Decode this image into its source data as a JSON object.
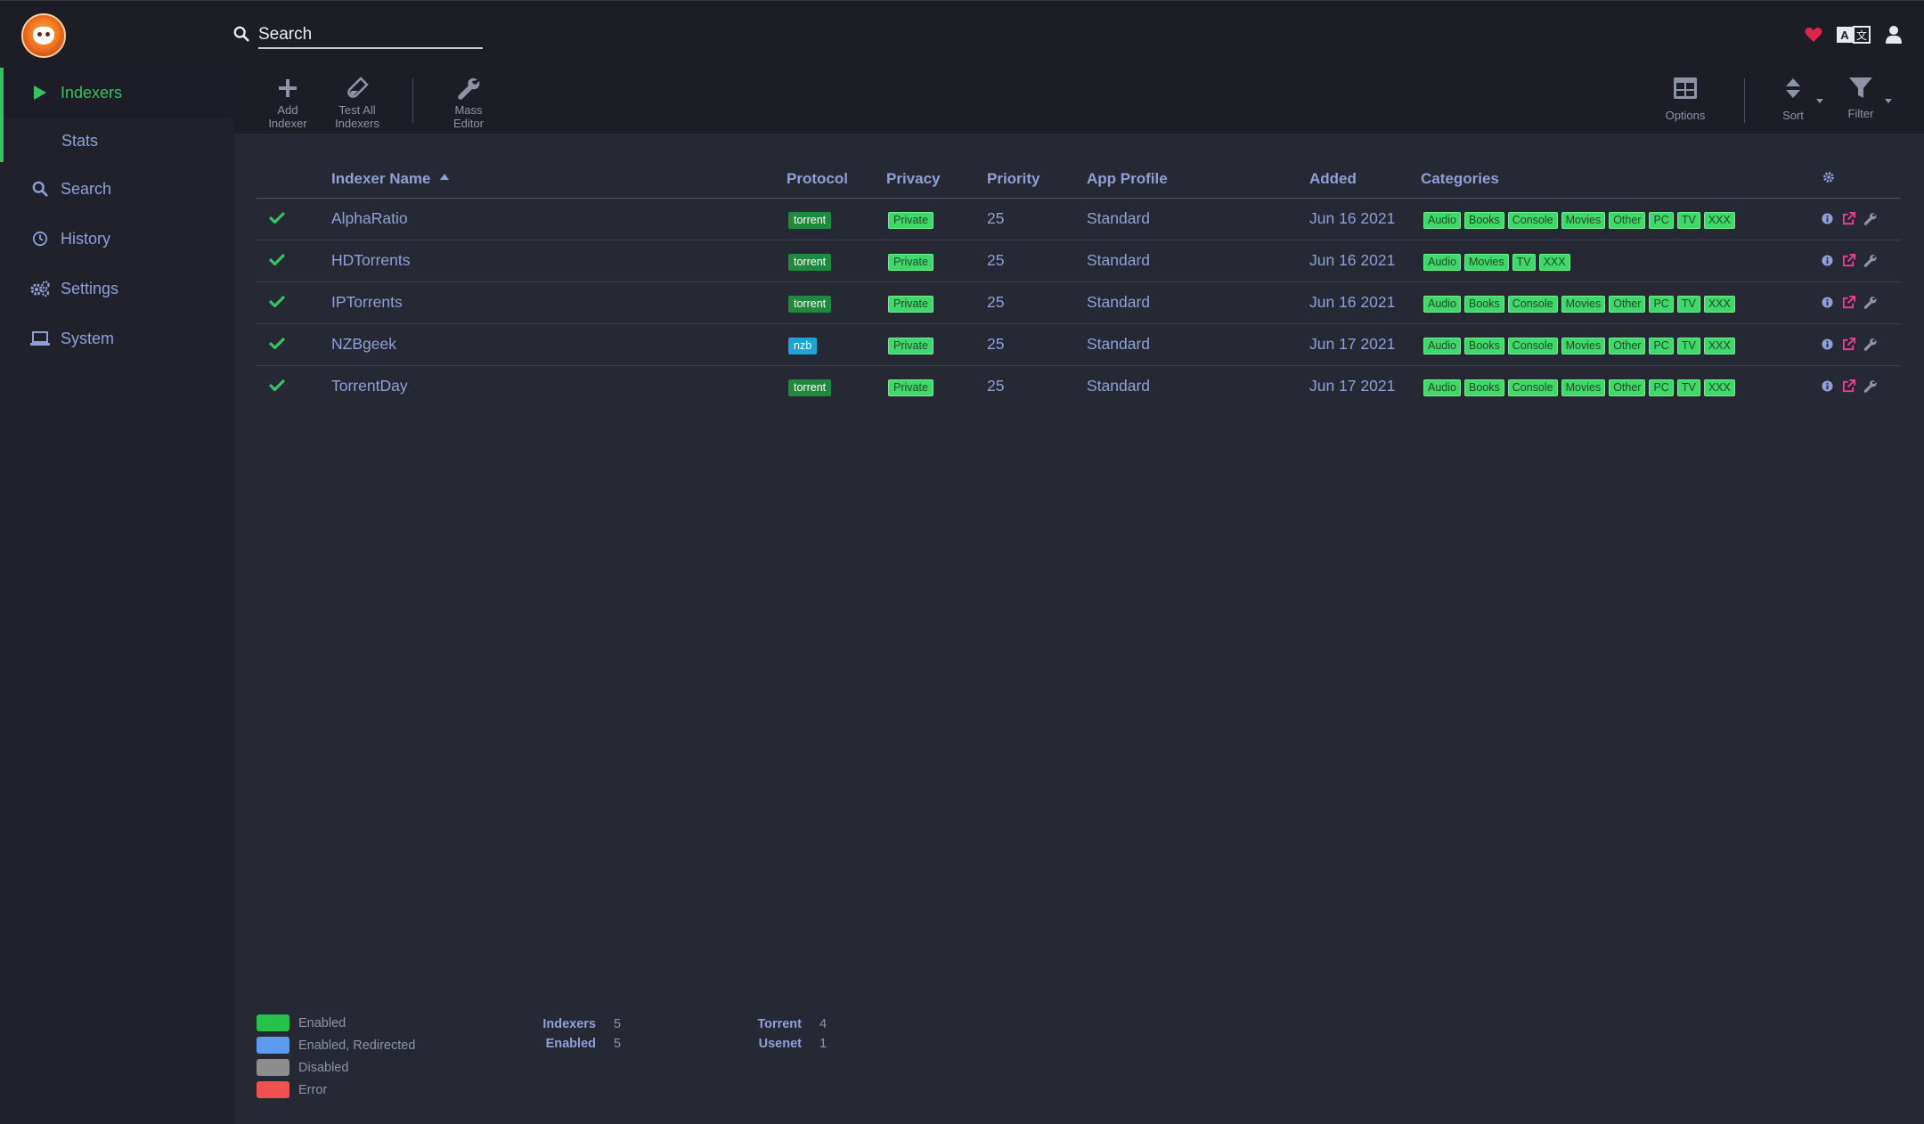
{
  "header": {
    "search_placeholder": "Search",
    "icons": [
      "heart-icon",
      "translate-icon",
      "user-icon"
    ]
  },
  "sidebar": {
    "items": [
      {
        "label": "Indexers",
        "icon": "play-icon",
        "active": true
      },
      {
        "label": "Stats",
        "sub": true
      },
      {
        "label": "Search",
        "icon": "search-icon"
      },
      {
        "label": "History",
        "icon": "history-icon"
      },
      {
        "label": "Settings",
        "icon": "cogs-icon"
      },
      {
        "label": "System",
        "icon": "laptop-icon"
      }
    ]
  },
  "toolbar": {
    "add_indexer": "Add Indexer",
    "test_all_indexers": "Test All Indexers",
    "mass_editor": "Mass Editor",
    "options": "Options",
    "sort": "Sort",
    "filter": "Filter"
  },
  "table": {
    "columns": {
      "name": "Indexer Name",
      "protocol": "Protocol",
      "privacy": "Privacy",
      "priority": "Priority",
      "app_profile": "App Profile",
      "added": "Added",
      "categories": "Categories"
    },
    "rows": [
      {
        "name": "AlphaRatio",
        "protocol": "torrent",
        "privacy": "Private",
        "priority": "25",
        "app_profile": "Standard",
        "added": "Jun 16 2021",
        "categories": [
          "Audio",
          "Books",
          "Console",
          "Movies",
          "Other",
          "PC",
          "TV",
          "XXX"
        ]
      },
      {
        "name": "HDTorrents",
        "protocol": "torrent",
        "privacy": "Private",
        "priority": "25",
        "app_profile": "Standard",
        "added": "Jun 16 2021",
        "categories": [
          "Audio",
          "Movies",
          "TV",
          "XXX"
        ]
      },
      {
        "name": "IPTorrents",
        "protocol": "torrent",
        "privacy": "Private",
        "priority": "25",
        "app_profile": "Standard",
        "added": "Jun 16 2021",
        "categories": [
          "Audio",
          "Books",
          "Console",
          "Movies",
          "Other",
          "PC",
          "TV",
          "XXX"
        ]
      },
      {
        "name": "NZBgeek",
        "protocol": "nzb",
        "privacy": "Private",
        "priority": "25",
        "app_profile": "Standard",
        "added": "Jun 17 2021",
        "categories": [
          "Audio",
          "Books",
          "Console",
          "Movies",
          "Other",
          "PC",
          "TV",
          "XXX"
        ]
      },
      {
        "name": "TorrentDay",
        "protocol": "torrent",
        "privacy": "Private",
        "priority": "25",
        "app_profile": "Standard",
        "added": "Jun 17 2021",
        "categories": [
          "Audio",
          "Books",
          "Console",
          "Movies",
          "Other",
          "PC",
          "TV",
          "XXX"
        ]
      }
    ]
  },
  "legend": [
    {
      "label": "Enabled",
      "color": "#27c24c"
    },
    {
      "label": "Enabled, Redirected",
      "color": "#5d9cec"
    },
    {
      "label": "Disabled",
      "color": "#8d8d8d"
    },
    {
      "label": "Error",
      "color": "#f05050"
    }
  ],
  "stats": {
    "indexers_label": "Indexers",
    "indexers": "5",
    "enabled_label": "Enabled",
    "enabled": "5",
    "torrent_label": "Torrent",
    "torrent": "4",
    "usenet_label": "Usenet",
    "usenet": "1"
  },
  "colors": {
    "accent": "#33c35f",
    "text": "#8fa0d8",
    "heart": "#e0254a",
    "action_pink": "#e5409a"
  }
}
